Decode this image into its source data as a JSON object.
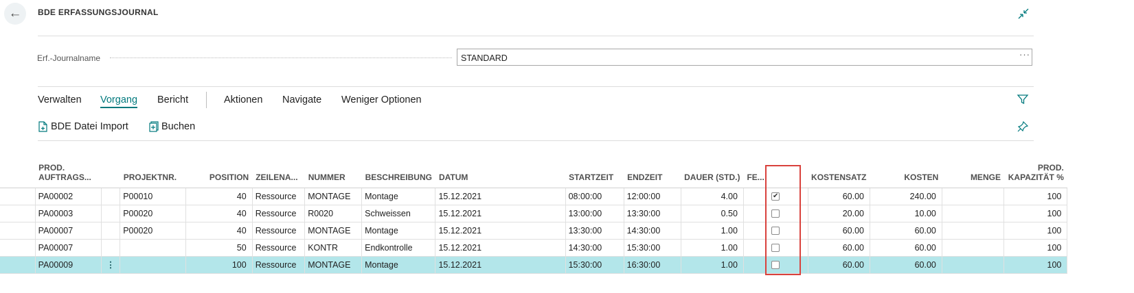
{
  "header": {
    "title": "BDE ERFASSUNGSJOURNAL"
  },
  "journal": {
    "label": "Erf.-Journalname",
    "value": "STANDARD",
    "more": "···"
  },
  "tabs": [
    "Verwalten",
    "Vorgang",
    "Bericht",
    "Aktionen",
    "Navigate",
    "Weniger Optionen"
  ],
  "actions": {
    "import_label": "BDE Datei Import",
    "post_label": "Buchen"
  },
  "table": {
    "headers": {
      "auftrag_1": "PROD.",
      "auftrag_2": "AUFTRAGS...",
      "projektnr": "PROJEKTNR.",
      "position": "POSITION",
      "zeilenart": "ZEILENA...",
      "nummer": "NUMMER",
      "beschreibung": "BESCHREIBUNG",
      "datum": "DATUM",
      "startzeit": "STARTZEIT",
      "endzeit": "ENDZEIT",
      "dauer": "DAUER (STD.)",
      "fe": "FE...",
      "kostensatz": "KOSTENSATZ",
      "kosten": "KOSTEN",
      "menge": "MENGE",
      "kap_1": "PROD.",
      "kap_2": "KAPAZITÄT %"
    },
    "rows": [
      {
        "auftrag": "PA00002",
        "projektnr": "P00010",
        "position": "40",
        "zeilenart": "Ressource",
        "nummer": "MONTAGE",
        "beschreibung": "Montage",
        "datum": "15.12.2021",
        "startzeit": "08:00:00",
        "endzeit": "12:00:00",
        "dauer": "4.00",
        "fe": true,
        "kostensatz": "60.00",
        "kosten": "240.00",
        "menge": "",
        "kapazitaet": "100"
      },
      {
        "auftrag": "PA00003",
        "projektnr": "P00020",
        "position": "40",
        "zeilenart": "Ressource",
        "nummer": "R0020",
        "beschreibung": "Schweissen",
        "datum": "15.12.2021",
        "startzeit": "13:00:00",
        "endzeit": "13:30:00",
        "dauer": "0.50",
        "fe": false,
        "kostensatz": "20.00",
        "kosten": "10.00",
        "menge": "",
        "kapazitaet": "100"
      },
      {
        "auftrag": "PA00007",
        "projektnr": "P00020",
        "position": "40",
        "zeilenart": "Ressource",
        "nummer": "MONTAGE",
        "beschreibung": "Montage",
        "datum": "15.12.2021",
        "startzeit": "13:30:00",
        "endzeit": "14:30:00",
        "dauer": "1.00",
        "fe": false,
        "kostensatz": "60.00",
        "kosten": "60.00",
        "menge": "",
        "kapazitaet": "100"
      },
      {
        "auftrag": "PA00007",
        "projektnr": "",
        "position": "50",
        "zeilenart": "Ressource",
        "nummer": "KONTR",
        "beschreibung": "Endkontrolle",
        "datum": "15.12.2021",
        "startzeit": "14:30:00",
        "endzeit": "15:30:00",
        "dauer": "1.00",
        "fe": false,
        "kostensatz": "60.00",
        "kosten": "60.00",
        "menge": "",
        "kapazitaet": "100"
      },
      {
        "auftrag": "PA00009",
        "projektnr": "",
        "position": "100",
        "zeilenart": "Ressource",
        "nummer": "MONTAGE",
        "beschreibung": "Montage",
        "datum": "15.12.2021",
        "startzeit": "15:30:00",
        "endzeit": "16:30:00",
        "dauer": "1.00",
        "fe": false,
        "kostensatz": "60.00",
        "kosten": "60.00",
        "menge": "",
        "kapazitaet": "100",
        "selected": true
      }
    ],
    "row_menu": "⋮"
  },
  "colors": {
    "accent": "#00797d",
    "selected_row": "#b3e6ea",
    "highlight_border": "#d9413c"
  }
}
